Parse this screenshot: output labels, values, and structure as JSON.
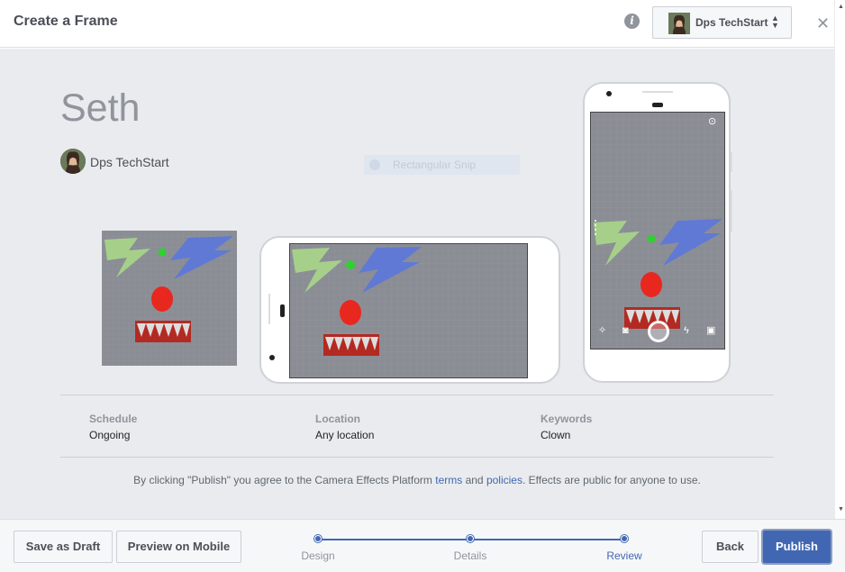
{
  "header": {
    "title": "Create a Frame",
    "account_name": "Dps TechStart"
  },
  "effect": {
    "name": "Seth",
    "creator": "Dps TechStart"
  },
  "ghost_overlay": {
    "text": "Rectangular Snip"
  },
  "details": {
    "schedule_label": "Schedule",
    "schedule_value": "Ongoing",
    "location_label": "Location",
    "location_value": "Any location",
    "keywords_label": "Keywords",
    "keywords_value": "Clown"
  },
  "legal": {
    "prefix": "By clicking \"Publish\" you agree to the Camera Effects Platform ",
    "terms": "terms",
    "and": " and ",
    "policies": "policies",
    "suffix": ". Effects are public for anyone to use."
  },
  "footer": {
    "save_draft": "Save as Draft",
    "preview_mobile": "Preview on Mobile",
    "back": "Back",
    "publish": "Publish",
    "steps": [
      "Design",
      "Details",
      "Review"
    ],
    "active_step": "Review"
  },
  "colors": {
    "accent": "#4267b2",
    "effect_bg": "#8b8d95",
    "green_bolt": "#a6d08a",
    "blue_bolt": "#6079d4",
    "red_nose": "#e8281e",
    "green_dot": "#2ed12e"
  }
}
